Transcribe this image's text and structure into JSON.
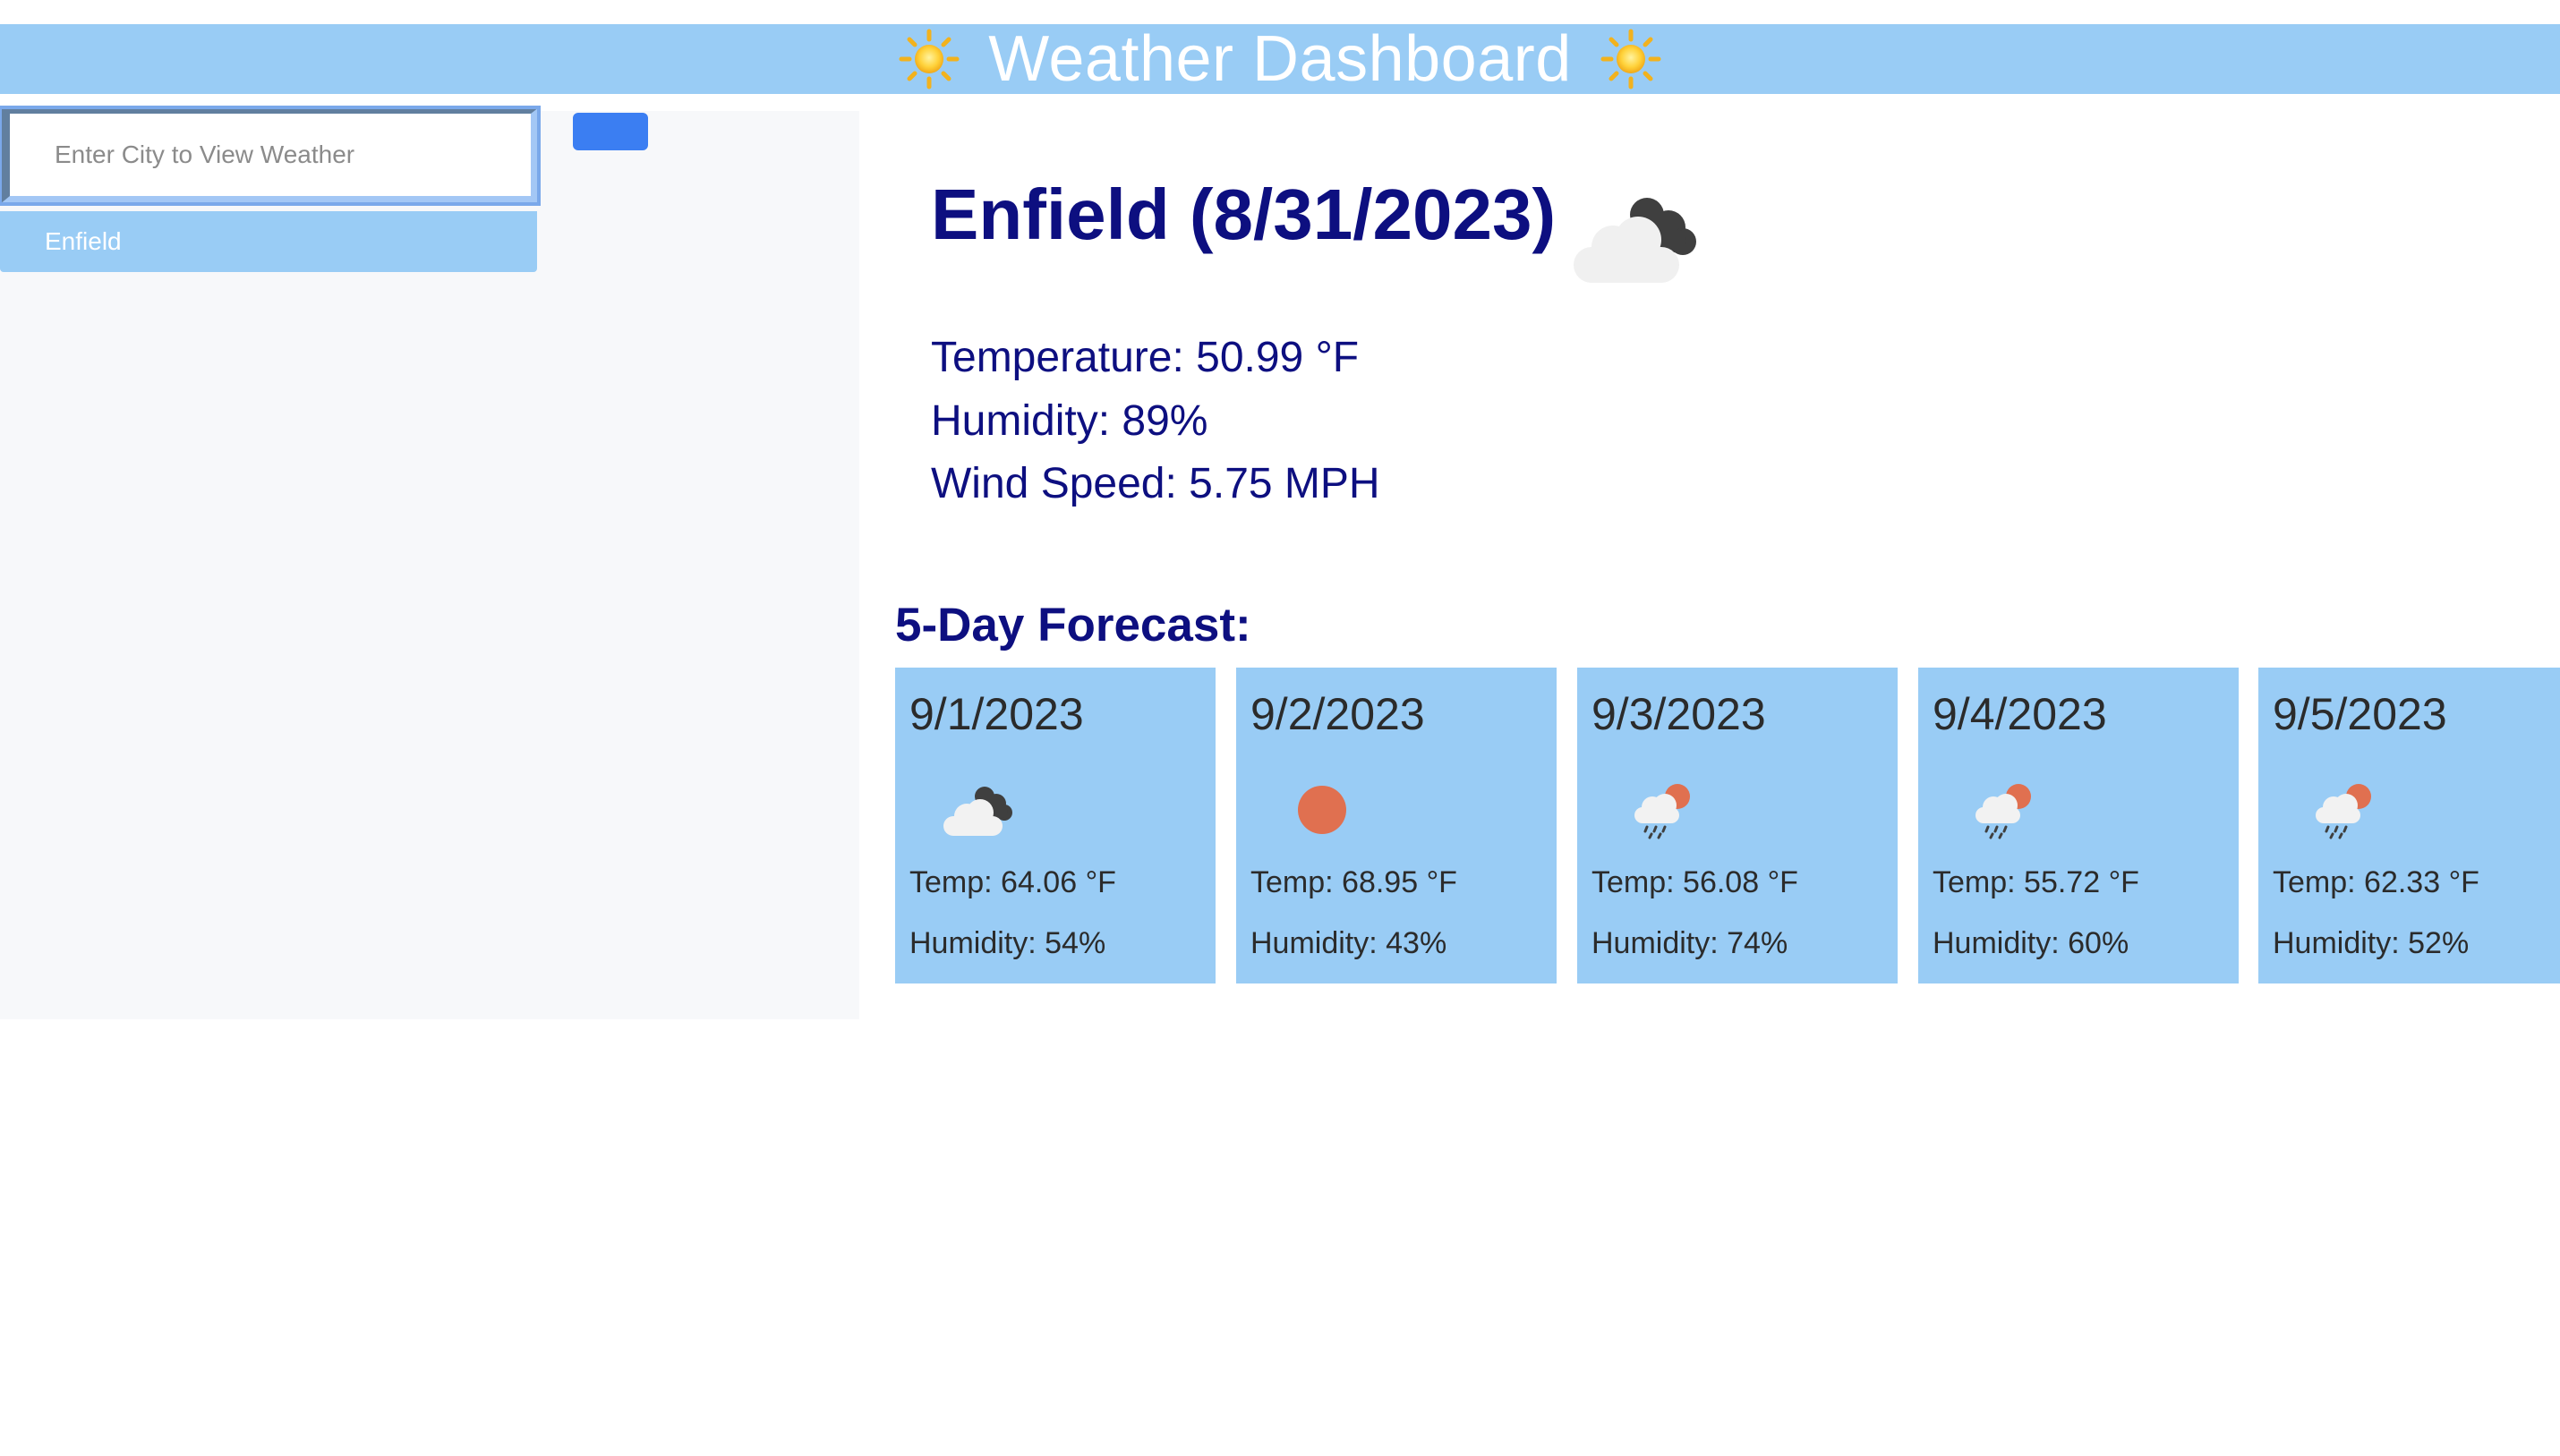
{
  "header": {
    "title": "Weather Dashboard",
    "left_icon": "sun-icon",
    "right_icon": "sun-icon",
    "background": "#99ccf5"
  },
  "search": {
    "placeholder": "Enter City to View Weather",
    "value": "",
    "button_label": "",
    "button_color": "#3b7ef2"
  },
  "history": {
    "items": [
      {
        "label": "Enfield"
      }
    ]
  },
  "current": {
    "heading": "Enfield (8/31/2023)",
    "icon": "broken-clouds-icon",
    "temperature": "Temperature: 50.99 °F",
    "humidity": "Humidity: 89%",
    "wind": "Wind Speed: 5.75 MPH",
    "text_color": "#0d0f80"
  },
  "forecast": {
    "heading": "5-Day Forecast:",
    "days": [
      {
        "date": "9/1/2023",
        "icon": "broken-clouds-icon",
        "temp": "Temp: 64.06 °F",
        "humidity": "Humidity: 54%"
      },
      {
        "date": "9/2/2023",
        "icon": "clear-sky-icon",
        "temp": "Temp: 68.95 °F",
        "humidity": "Humidity: 43%"
      },
      {
        "date": "9/3/2023",
        "icon": "rain-icon",
        "temp": "Temp: 56.08 °F",
        "humidity": "Humidity: 74%"
      },
      {
        "date": "9/4/2023",
        "icon": "rain-icon",
        "temp": "Temp: 55.72 °F",
        "humidity": "Humidity: 60%"
      },
      {
        "date": "9/5/2023",
        "icon": "rain-icon",
        "temp": "Temp: 62.33 °F",
        "humidity": "Humidity: 52%"
      }
    ],
    "card_color": "#99ccf5"
  }
}
